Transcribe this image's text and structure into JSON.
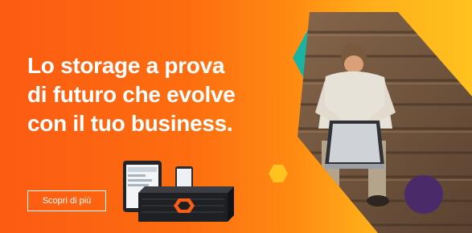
{
  "banner": {
    "headline_lines": [
      "Lo storage a prova",
      "di futuro che evolve",
      "con il tuo business."
    ],
    "cta_label": "Scopri di più"
  },
  "colors": {
    "gradient_start": "#fb5b12",
    "gradient_end": "#ffc21e",
    "teal_hexagon": "#1ab2a0",
    "yellow_dot": "#ffc21e",
    "purple_dot": "#4b2a6a",
    "text": "#ffffff"
  },
  "icons": {
    "logo": "pure-storage-logo-icon"
  }
}
